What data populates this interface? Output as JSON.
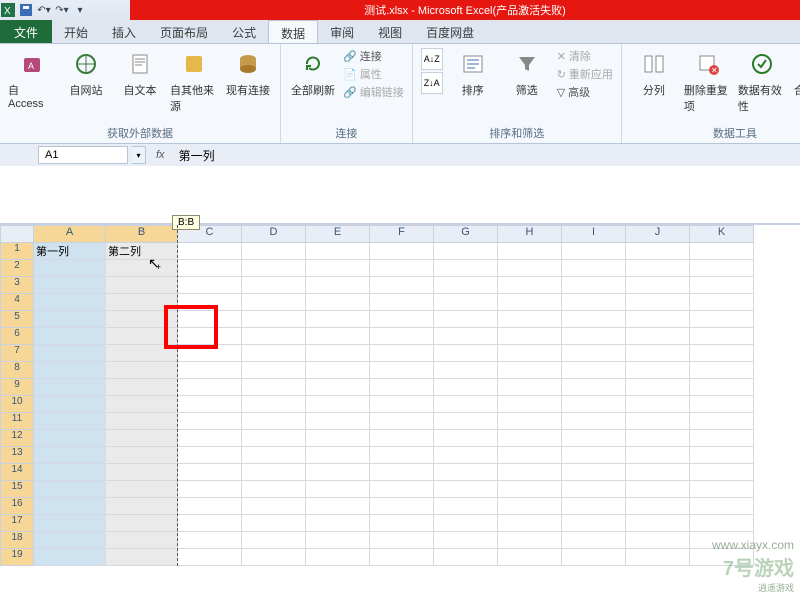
{
  "title": "测试.xlsx - Microsoft Excel(产品激活失败)",
  "tabs": {
    "file": "文件",
    "home": "开始",
    "insert": "插入",
    "layout": "页面布局",
    "formulas": "公式",
    "data": "数据",
    "review": "审阅",
    "view": "视图",
    "baidu": "百度网盘"
  },
  "ribbon": {
    "ext": {
      "access": "自 Access",
      "web": "自网站",
      "text": "自文本",
      "other": "自其他来源",
      "existing": "现有连接",
      "label": "获取外部数据"
    },
    "conn": {
      "refresh": "全部刷新",
      "connect": "连接",
      "props": "属性",
      "editlinks": "编辑链接",
      "label": "连接"
    },
    "sort": {
      "sort": "排序",
      "filter": "筛选",
      "clear": "清除",
      "reapply": "重新应用",
      "advanced": "高级",
      "label": "排序和筛选"
    },
    "tools": {
      "split": "分列",
      "dedup": "删除重复项",
      "valid": "数据有效性",
      "consol": "合并计算",
      "label": "数据工具"
    }
  },
  "namebox": "A1",
  "fx_label": "fx",
  "formula_value": "第一列",
  "tooltip": "B:B",
  "cells": {
    "a1": "第一列",
    "b1": "第二列"
  },
  "cols": [
    "A",
    "B",
    "C",
    "D",
    "E",
    "F",
    "G",
    "H",
    "I",
    "J",
    "K"
  ],
  "rows": [
    "1",
    "2",
    "3",
    "4",
    "5",
    "6",
    "7",
    "8",
    "9",
    "10",
    "11",
    "12",
    "13",
    "14",
    "15",
    "16",
    "17",
    "18",
    "19"
  ],
  "watermark": {
    "url": "www.xiayx.com",
    "brand": "7号游戏",
    "sub": "逍遥游戏"
  }
}
